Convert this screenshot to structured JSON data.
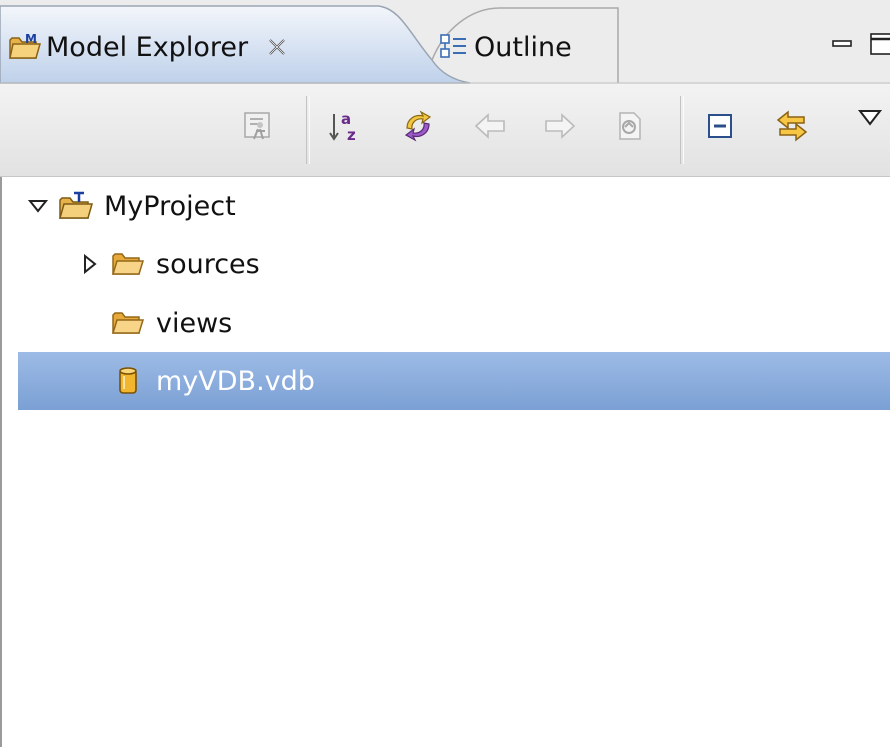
{
  "tabs": [
    {
      "label": "Model Explorer",
      "active": true,
      "icon": "model-explorer-icon",
      "closable": true
    },
    {
      "label": "Outline",
      "active": false,
      "icon": "outline-icon",
      "closable": false
    }
  ],
  "view_controls": [
    "minimize-icon",
    "maximize-icon"
  ],
  "toolbar": {
    "buttons": [
      {
        "icon": "run-icon",
        "enabled": false
      },
      {
        "icon": "sort-alphabetical-icon",
        "enabled": true
      },
      {
        "icon": "sync-icon",
        "enabled": true
      },
      {
        "icon": "back-arrow-icon",
        "enabled": false
      },
      {
        "icon": "forward-arrow-icon",
        "enabled": false
      },
      {
        "icon": "home-icon",
        "enabled": false
      },
      {
        "icon": "collapse-all-icon",
        "enabled": true
      },
      {
        "icon": "link-with-editor-icon",
        "enabled": true
      },
      {
        "icon": "view-menu-icon",
        "enabled": true
      }
    ]
  },
  "tree": {
    "items": [
      {
        "label": "MyProject",
        "icon": "project-icon",
        "level": 0,
        "expanded": true
      },
      {
        "label": "sources",
        "icon": "folder-icon",
        "level": 1,
        "expanded": false,
        "has_children": true
      },
      {
        "label": "views",
        "icon": "folder-icon",
        "level": 1,
        "has_children": false
      },
      {
        "label": "myVDB.vdb",
        "icon": "vdb-icon",
        "level": 1,
        "selected": true
      }
    ]
  },
  "colors": {
    "selection": "#7ba0d4",
    "active_tab": "#c8d8ee",
    "toolbar": "#e8e8e8",
    "folder": "#f0b548",
    "vdb": "#e9a21c"
  }
}
